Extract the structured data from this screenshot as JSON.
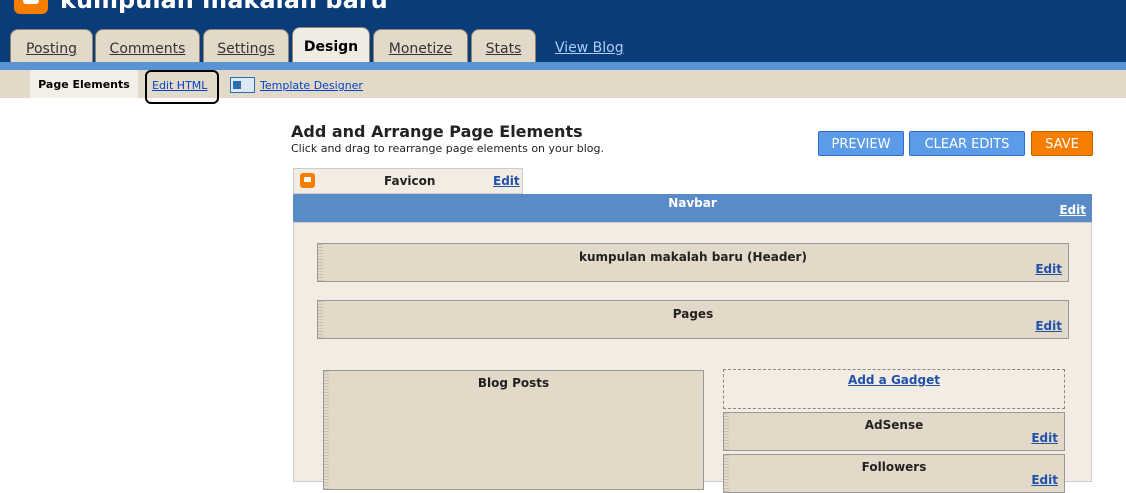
{
  "header": {
    "blog_title": "kumpulan makalah baru",
    "tabs": [
      {
        "label": "Posting"
      },
      {
        "label": "Comments"
      },
      {
        "label": "Settings"
      },
      {
        "label": "Design"
      },
      {
        "label": "Monetize"
      },
      {
        "label": "Stats"
      }
    ],
    "view_blog": "View Blog"
  },
  "subnav": {
    "page_elements": "Page Elements",
    "edit_html": "Edit HTML",
    "template_designer": "Template Designer"
  },
  "main": {
    "heading": "Add and Arrange Page Elements",
    "subheading": "Click and drag to rearrange page elements on your blog.",
    "buttons": {
      "preview": "PREVIEW",
      "clear": "CLEAR EDITS",
      "save": "SAVE"
    },
    "edit_label": "Edit",
    "favicon": "Favicon",
    "navbar": "Navbar",
    "header_widget": "kumpulan makalah baru (Header)",
    "pages_widget": "Pages",
    "blog_posts": "Blog Posts",
    "add_gadget": "Add a Gadget",
    "adsense": "AdSense",
    "followers": "Followers"
  },
  "colors": {
    "brand": "#f57d00",
    "header_bg": "#0b3c7a",
    "accent_blue": "#5b9be8"
  }
}
